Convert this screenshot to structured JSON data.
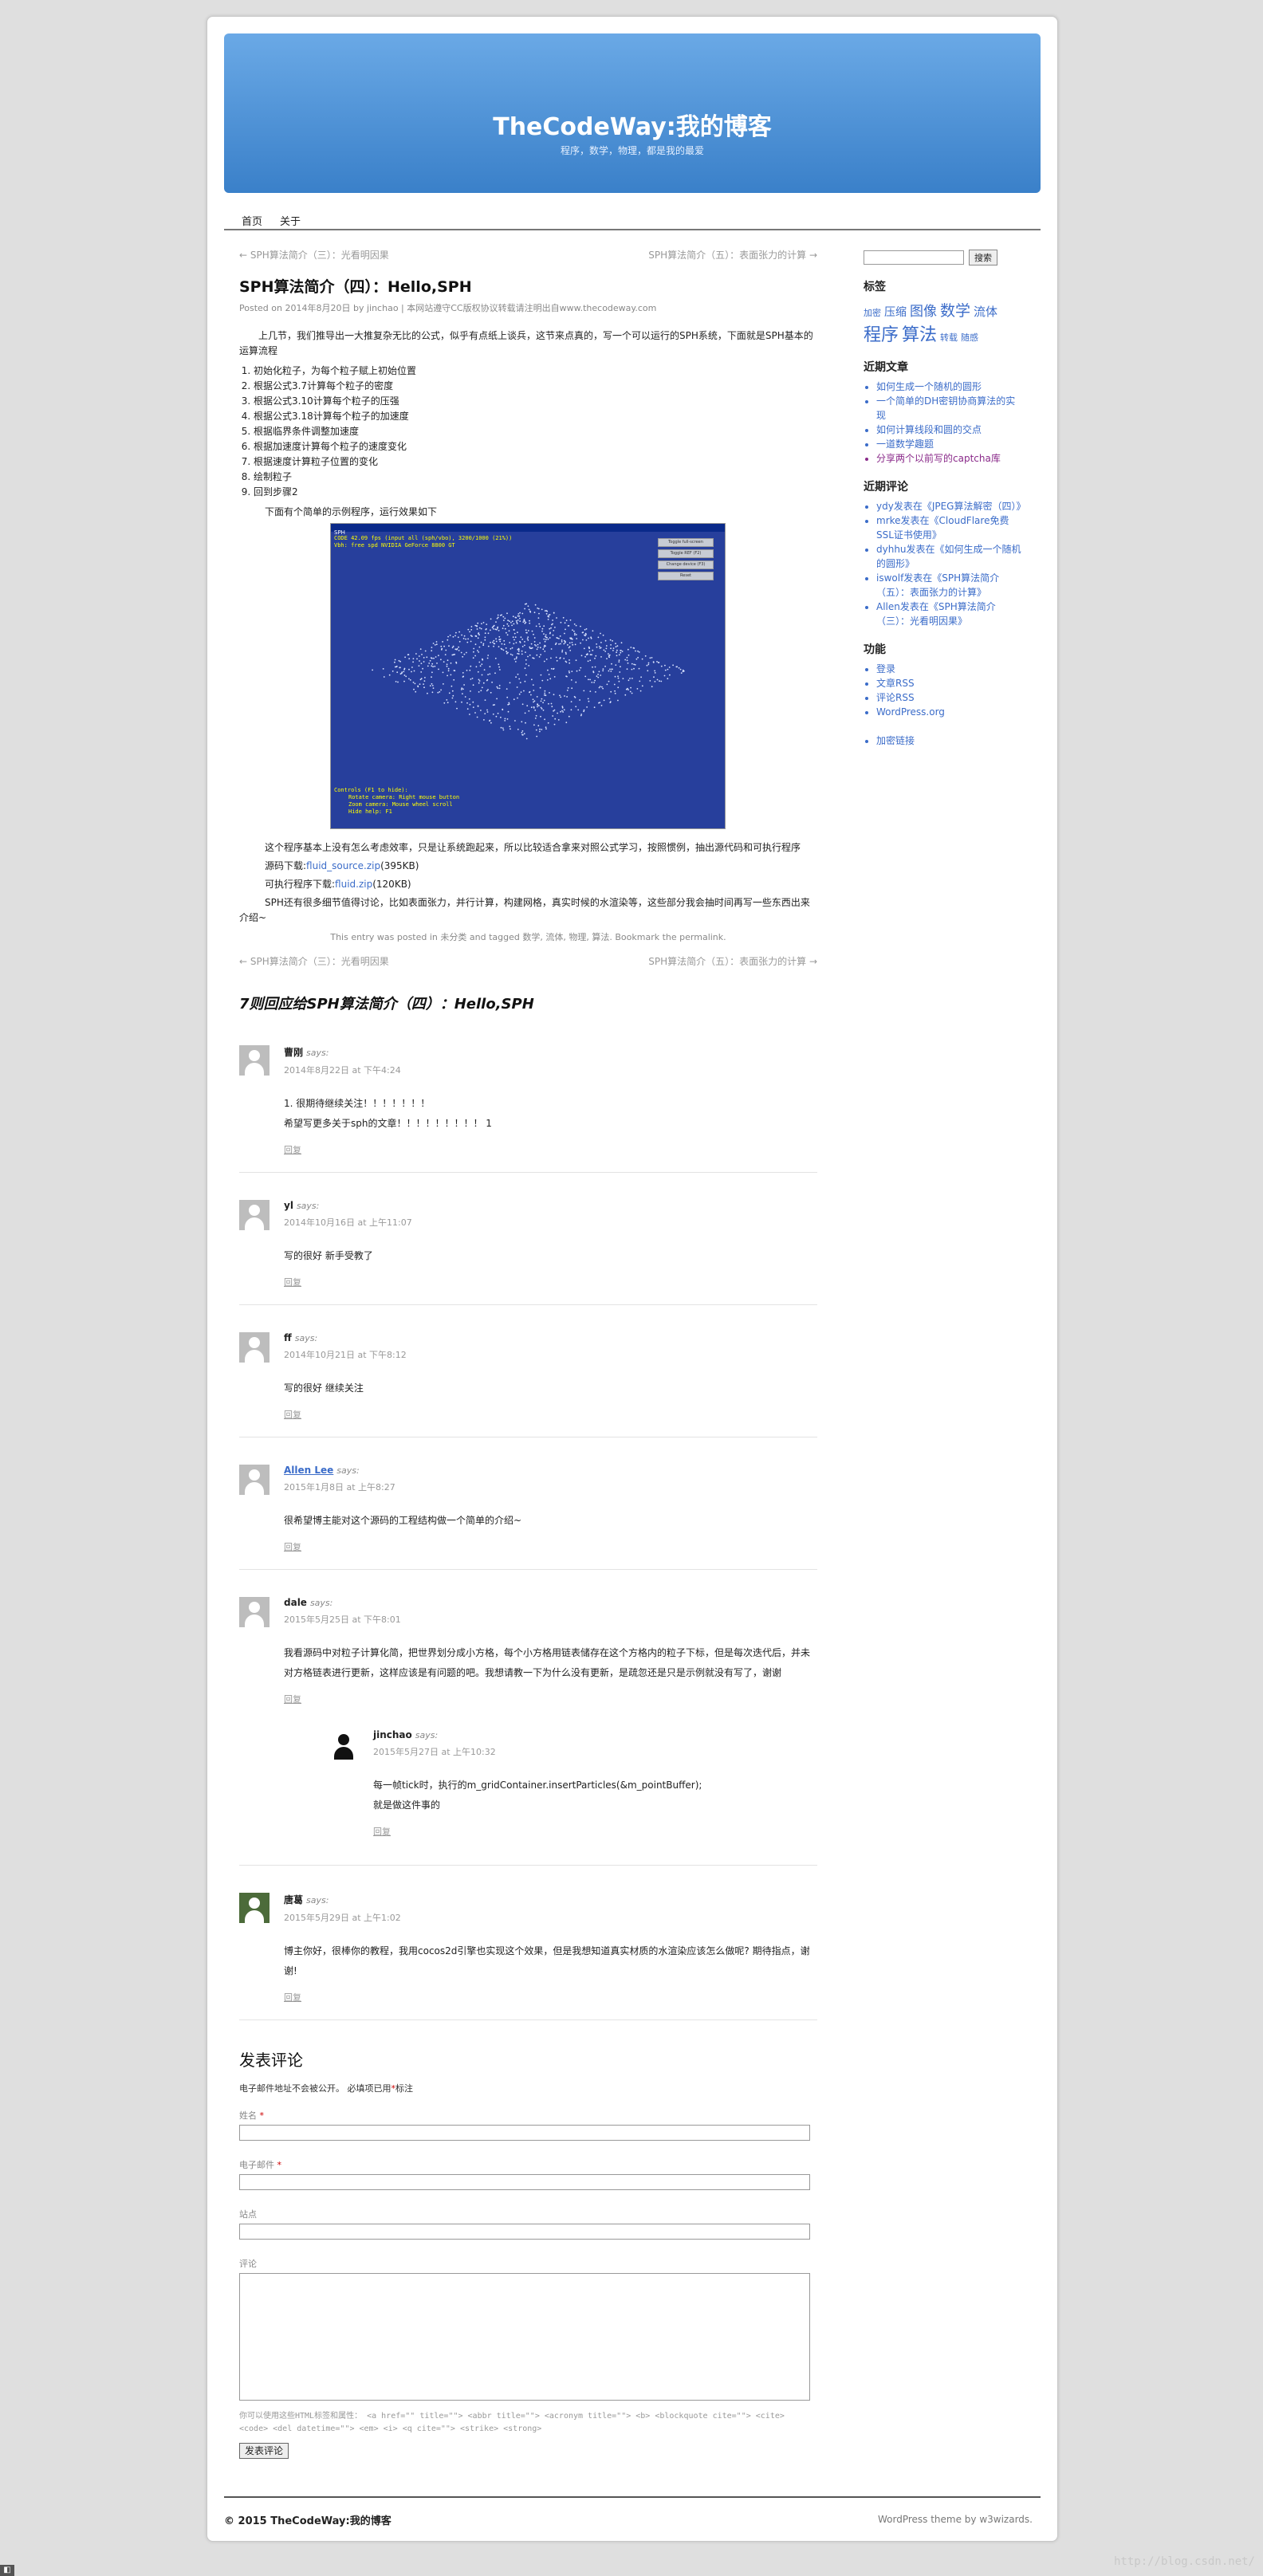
{
  "header": {
    "title": "TheCodeWay:我的博客",
    "description": "程序，数学，物理，都是我的最爱"
  },
  "nav": {
    "items": [
      "首页",
      "关于"
    ]
  },
  "post_nav": {
    "prev": "← SPH算法简介（三）：光看明因果",
    "next": "SPH算法简介（五）：表面张力的计算 →"
  },
  "post": {
    "title": "SPH算法简介（四）：Hello,SPH",
    "meta_prefix": "Posted on",
    "meta_date": "2014年8月20日",
    "meta_by": "by",
    "meta_author": "jinchao",
    "meta_license_prefix": "| 本网站遵守",
    "meta_license": "CC版权协议",
    "meta_license_suffix": "转载请注明出自",
    "meta_site": "www.thecodeway.com",
    "intro": "上几节，我们推导出一大推复杂无比的公式，似乎有点纸上谈兵，这节来点真的，写一个可以运行的SPH系统，下面就是SPH基本的运算流程",
    "steps": [
      "初始化粒子，为每个粒子赋上初始位置",
      "根据公式3.7计算每个粒子的密度",
      "根据公式3.10计算每个粒子的压强",
      "根据公式3.18计算每个粒子的加速度",
      "根据临界条件调整加速度",
      "根据加速度计算每个粒子的速度变化",
      "根据速度计算粒子位置的变化",
      "绘制粒子",
      "回到步骤2"
    ],
    "demo_caption": "下面有个简单的示例程序，运行效果如下",
    "demo_window_title": "SPH",
    "demo_info": [
      "CODE 42.09 fps (input all (sph/vbo), 3200/1000 (21%))",
      "Vbh: free spd NVIDIA GeForce 8800 GT"
    ],
    "demo_buttons": [
      "Toggle full-screen",
      "Toggle REF (F2)",
      "Change device (F3)",
      "Reset"
    ],
    "demo_controls": [
      "Controls (F1 to hide):",
      "Rotate camera: Right mouse button",
      "Zoom camera: Mouse wheel scroll",
      "Hide help: F1"
    ],
    "after_demo": "这个程序基本上没有怎么考虑效率，只是让系统跑起来，所以比较适合拿来对照公式学习，按照惯例，抽出源代码和可执行程序",
    "src_label": "源码下载:",
    "src_link": "fluid_source.zip",
    "src_size": "(395KB)",
    "bin_label": "可执行程序下载:",
    "bin_link": "fluid.zip",
    "bin_size": "(120KB)",
    "closing": "SPH还有很多细节值得讨论，比如表面张力，并行计算，构建网格，真实时候的水渲染等，这些部分我会抽时间再写一些东西出来介绍~"
  },
  "post_footer": {
    "text1": "This entry was posted in",
    "category": "未分类",
    "text2": "and tagged",
    "tags": [
      "数学",
      "流体",
      "物理",
      "算法"
    ],
    "text3": "Bookmark the",
    "permalink": "permalink"
  },
  "comments_title": "7则回应给SPH算法简介（四）：Hello,SPH",
  "comments": [
    {
      "author": "曹刚",
      "says": "says:",
      "date": "2014年8月22日 at 下午4:24",
      "lines": [
        "1. 很期待继续关注！！！！！！！",
        "希望写更多关于sph的文章！！！！！！！！！ 1"
      ],
      "reply": "回复"
    },
    {
      "author": "yl",
      "says": "says:",
      "date": "2014年10月16日 at 上午11:07",
      "lines": [
        "写的很好 新手受教了"
      ],
      "reply": "回复"
    },
    {
      "author": "ff",
      "says": "says:",
      "date": "2014年10月21日 at 下午8:12",
      "lines": [
        "写的很好 继续关注"
      ],
      "reply": "回复"
    },
    {
      "author": "Allen Lee",
      "says": "says:",
      "date": "2015年1月8日 at 上午8:27",
      "lines": [
        "很希望博主能对这个源码的工程结构做一个简单的介绍~"
      ],
      "reply": "回复"
    },
    {
      "author": "dale",
      "says": "says:",
      "date": "2015年5月25日 at 下午8:01",
      "lines": [
        "我看源码中对粒子计算化简，把世界划分成小方格，每个小方格用链表储存在这个方格内的粒子下标，但是每次迭代后，并未对方格链表进行更新，这样应该是有问题的吧。我想请教一下为什么没有更新，是疏忽还是只是示例就没有写了，谢谢"
      ],
      "reply": "回复"
    },
    {
      "author": "jinchao",
      "says": "says:",
      "date": "2015年5月27日 at 上午10:32",
      "lines": [
        "每一帧tick时，执行的m_gridContainer.insertParticles(&m_pointBuffer);",
        "就是做这件事的"
      ],
      "reply": "回复"
    },
    {
      "author": "唐葛",
      "says": "says:",
      "date": "2015年5月29日 at 上午1:02",
      "lines": [
        "博主你好，很棒你的教程，我用cocos2d引擎也实现这个效果，但是我想知道真实材质的水渲染应该怎么做呢? 期待指点，谢谢!"
      ],
      "reply": "回复"
    }
  ],
  "respond": {
    "title": "发表评论",
    "note": "电子邮件地址不会被公开。 必填项已用",
    "note_mark": "*",
    "note_suffix": "标注",
    "name_label": "姓名",
    "email_label": "电子邮件",
    "site_label": "站点",
    "comment_label": "评论",
    "allowed": "你可以使用这些HTML标签和属性： <a href=\"\" title=\"\"> <abbr title=\"\"> <acronym title=\"\"> <b> <blockquote cite=\"\"> <cite> <code> <del datetime=\"\"> <em> <i> <q cite=\"\"> <strike> <strong>",
    "submit": "发表评论"
  },
  "sidebar": {
    "search_button": "搜索",
    "tags_title": "标签",
    "tags": [
      {
        "label": "加密",
        "size": 11
      },
      {
        "label": "压缩",
        "size": 14
      },
      {
        "label": "图像",
        "size": 17
      },
      {
        "label": "数学",
        "size": 19
      },
      {
        "label": "流体",
        "size": 15
      },
      {
        "label": "程序",
        "size": 22
      },
      {
        "label": "算法",
        "size": 22
      },
      {
        "label": "转载",
        "size": 11
      },
      {
        "label": "随感",
        "size": 11
      }
    ],
    "recent_posts_title": "近期文章",
    "recent_posts": [
      "如何生成一个随机的圆形",
      "一个简单的DH密钥协商算法的实现",
      "如何计算线段和圆的交点",
      "一道数学趣题",
      "分享两个以前写的captcha库"
    ],
    "recent_comments_title": "近期评论",
    "recent_comments": [
      "ydy发表在《JPEG算法解密（四）》",
      "mrke发表在《CloudFlare免费SSL证书使用》",
      "dyhhu发表在《如何生成一个随机的圆形》",
      "iswolf发表在《SPH算法简介（五）：表面张力的计算》",
      "Allen发表在《SPH算法简介（三）：光看明因果》"
    ],
    "meta_title": "功能",
    "meta_links": [
      "登录",
      "文章RSS",
      "评论RSS",
      "WordPress.org"
    ],
    "extra_link": "加密链接"
  },
  "footer": {
    "copyright": "© 2015 TheCodeWay:我的博客",
    "theme": "WordPress theme by w3wizards."
  },
  "watermark": "http://blog.csdn.net/"
}
